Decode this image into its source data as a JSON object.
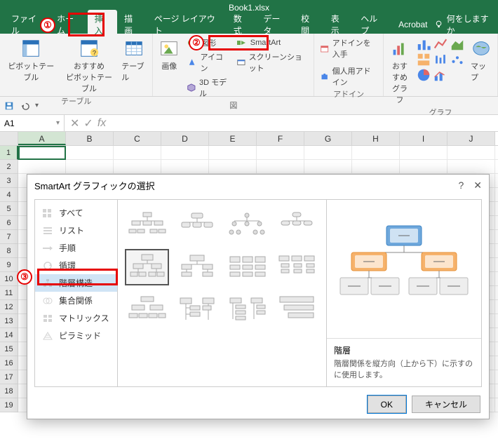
{
  "title": "Book1.xlsx",
  "tabs": [
    "ファイル",
    "ホーム",
    "挿入",
    "描画",
    "ページ レイアウト",
    "数式",
    "データ",
    "校閲",
    "表示",
    "ヘルプ",
    "Acrobat"
  ],
  "tellme": "何をしますか",
  "ribbon": {
    "tables": {
      "pivot": "ピボットテーブル",
      "recpivot": "おすすめ\nピボットテーブル",
      "table": "テーブル",
      "label": "テーブル"
    },
    "illus": {
      "images": "画像",
      "shapes": "図形",
      "icons": "アイコン",
      "smartart": "SmartArt",
      "model3d": "3D モデル",
      "screenshot": "スクリーンショット",
      "label": "図"
    },
    "addins": {
      "get": "アドインを入手",
      "my": "個人用アドイン",
      "label": "アドイン"
    },
    "charts": {
      "rec": "おすすめ\nグラフ",
      "map": "マップ",
      "label": "グラフ"
    }
  },
  "namebox": "A1",
  "cols": [
    "A",
    "B",
    "C",
    "D",
    "E",
    "F",
    "G",
    "H",
    "I",
    "J"
  ],
  "rows": [
    "1",
    "2",
    "3",
    "4",
    "5",
    "6",
    "7",
    "8",
    "9",
    "10",
    "11",
    "12",
    "13",
    "14",
    "15",
    "16",
    "17",
    "18",
    "19"
  ],
  "dialog": {
    "title": "SmartArt グラフィックの選択",
    "help": "?",
    "categories": [
      "すべて",
      "リスト",
      "手順",
      "循環",
      "階層構造",
      "集合関係",
      "マトリックス",
      "ピラミッド"
    ],
    "selectedCategory": 4,
    "preview": {
      "heading": "階層",
      "desc": "階層関係を縦方向（上から下）に示すのに使用します。"
    },
    "ok": "OK",
    "cancel": "キャンセル"
  },
  "callouts": {
    "1": "①",
    "2": "②",
    "3": "③"
  },
  "chart_data": null
}
